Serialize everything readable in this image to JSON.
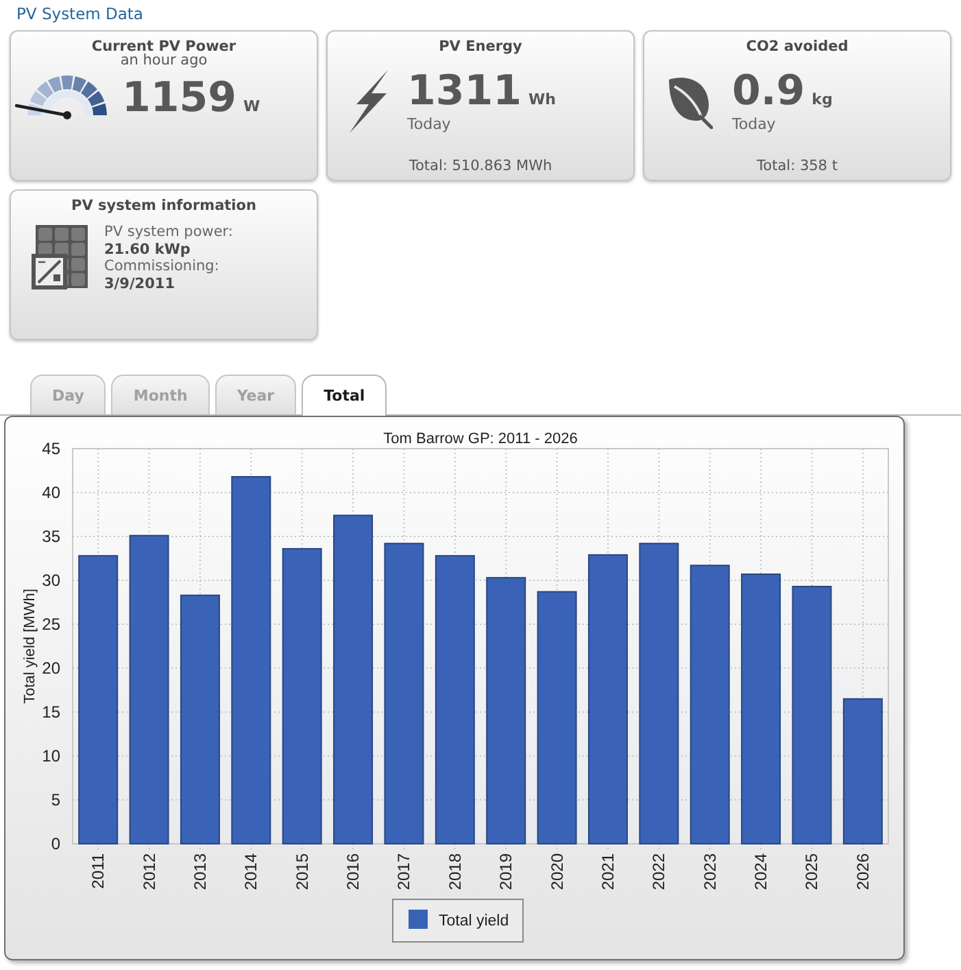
{
  "header": {
    "title": "PV System Data"
  },
  "cards": [
    {
      "kind": "power",
      "title": "Current PV Power",
      "subtitle": "an hour ago",
      "value": "1159",
      "unit": "W"
    },
    {
      "kind": "energy",
      "title": "PV Energy",
      "value": "1311",
      "unit": "Wh",
      "period": "Today",
      "total": "Total: 510.863 MWh"
    },
    {
      "kind": "co2",
      "title": "CO2 avoided",
      "value": "0.9",
      "unit": "kg",
      "period": "Today",
      "total": "Total: 358 t"
    },
    {
      "kind": "info",
      "title": "PV system information",
      "facts": [
        {
          "label": "PV system power:",
          "value": "21.60 kWp"
        },
        {
          "label": "Commissioning:",
          "value": "3/9/2011"
        }
      ]
    }
  ],
  "tabs": [
    {
      "label": "Day",
      "selected": false
    },
    {
      "label": "Month",
      "selected": false
    },
    {
      "label": "Year",
      "selected": false
    },
    {
      "label": "Total",
      "selected": true
    }
  ],
  "chart": {
    "chart_data": {
      "type": "bar",
      "title": "Tom Barrow GP: 2011 - 2026",
      "ylabel": "Total yield [MWh]",
      "categories": [
        "2011",
        "2012",
        "2013",
        "2014",
        "2015",
        "2016",
        "2017",
        "2018",
        "2019",
        "2020",
        "2021",
        "2022",
        "2023",
        "2024",
        "2025",
        "2026"
      ],
      "series": [
        {
          "name": "Total yield",
          "color": "#3a63b8",
          "values": [
            32.8,
            35.1,
            28.3,
            41.8,
            33.6,
            37.4,
            34.2,
            32.8,
            30.3,
            28.7,
            32.9,
            34.2,
            31.7,
            30.7,
            29.3,
            16.5
          ]
        }
      ],
      "ylim": [
        0,
        45
      ],
      "yticks": [
        0,
        5,
        10,
        15,
        20,
        25,
        30,
        35,
        40,
        45
      ],
      "grid": true
    }
  }
}
